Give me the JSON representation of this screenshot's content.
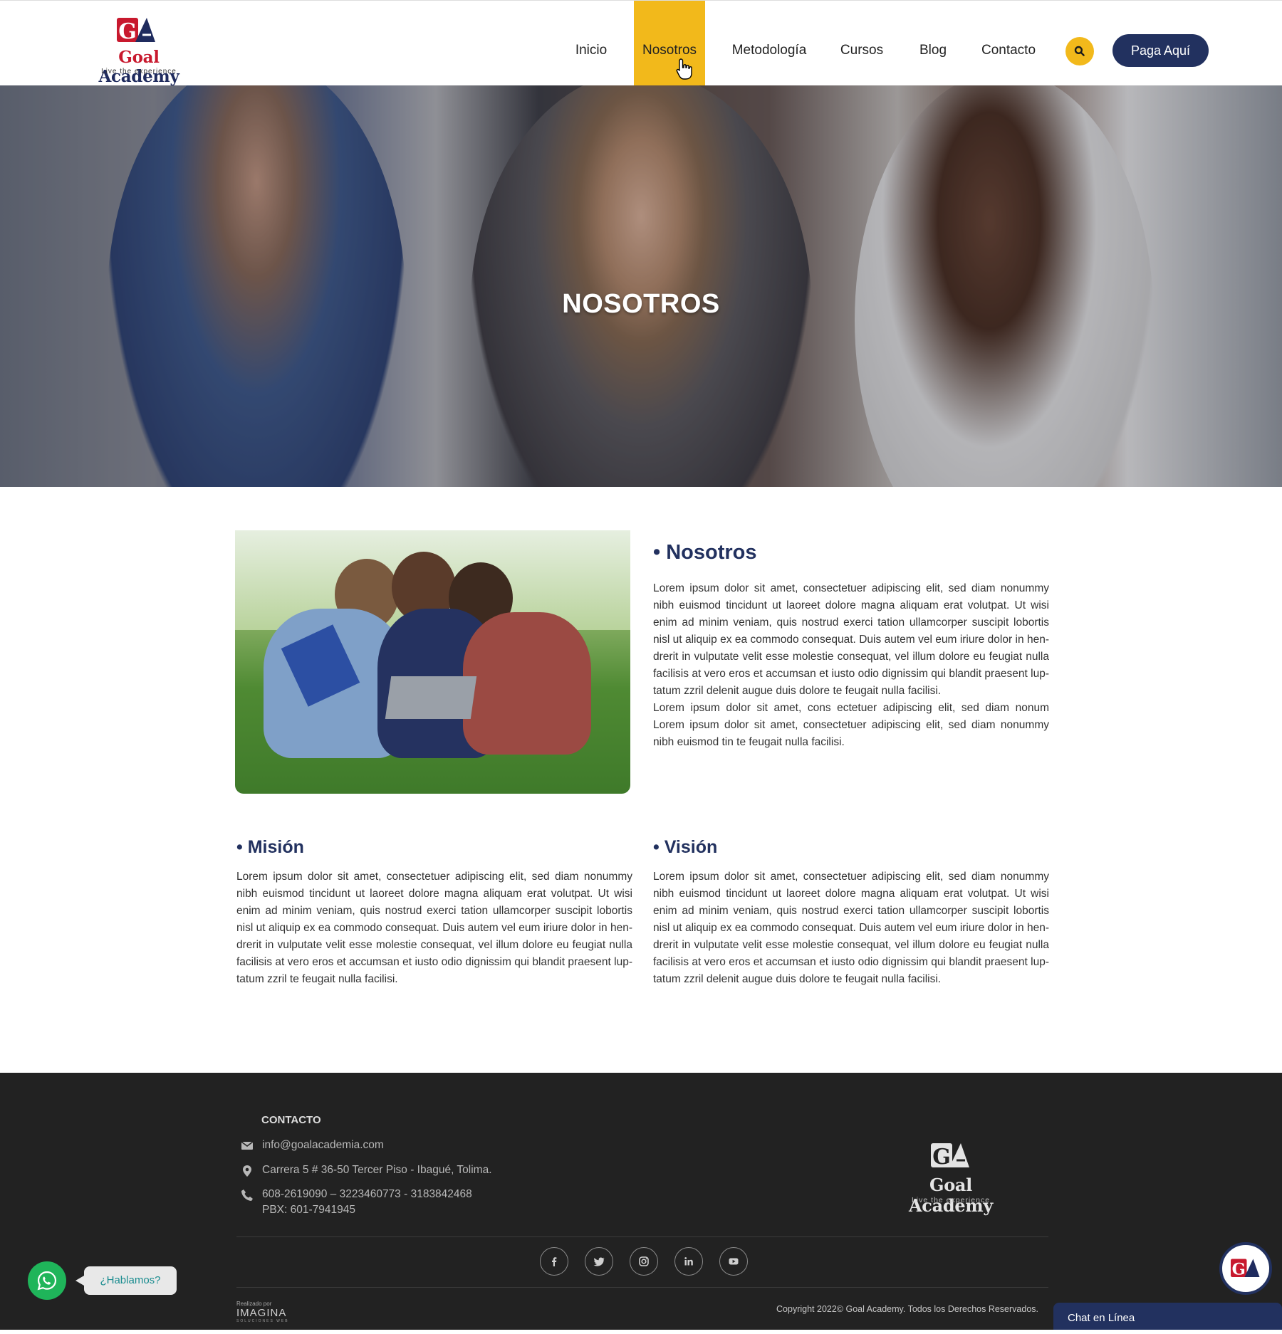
{
  "header": {
    "logo": {
      "name_part1": "Goal",
      "name_part2": "Academy",
      "tagline": "Live the experience",
      "mark": "GA"
    },
    "nav": [
      {
        "label": "Inicio"
      },
      {
        "label": "Nosotros",
        "active": true
      },
      {
        "label": "Metodología"
      },
      {
        "label": "Cursos"
      },
      {
        "label": "Blog"
      },
      {
        "label": "Contacto"
      }
    ],
    "search_icon": "search-icon",
    "pay_button": "Paga Aquí",
    "accent_color": "#f2b91b",
    "brand_color": "#22315f"
  },
  "hero": {
    "title": "NOSOTROS"
  },
  "about": {
    "title": "• Nosotros",
    "paragraphs": [
      "Lorem ipsum dolor sit amet, consectetuer adipiscing elit, sed diam nonummy nibh euismod tincidunt ut laoreet dolore magna aliquam erat volutpat. Ut wisi enim ad minim veniam, quis nostrud exerci tation ullamcorper suscipit lobortis nisl ut aliquip ex ea commodo consequat. Duis autem vel eum iriure dolor in hen-drerit in vulputate velit esse molestie consequat, vel illum dolore eu feugiat nulla facilisis at vero eros et accumsan et iusto odio dignissim qui blandit praesent lup-tatum zzril delenit augue duis dolore te feugait nulla facilisi.",
      "Lorem ipsum dolor sit amet, cons ectetuer adipiscing elit, sed diam nonum Lorem ipsum dolor sit amet, consectetuer adipiscing elit, sed diam nonummy nibh euismod tin te feugait nulla facilisi."
    ]
  },
  "mision": {
    "title": "• Misión",
    "text": "Lorem ipsum dolor sit amet, consectetuer adipiscing elit, sed diam nonummy nibh euismod tincidunt ut laoreet dolore magna aliquam erat volutpat. Ut wisi enim ad minim veniam, quis nostrud exerci tation ullamcorper suscipit lobortis nisl ut aliquip ex ea commodo consequat. Duis autem vel eum iriure dolor in hen-drerit in vulputate velit esse molestie consequat, vel illum dolore eu feugiat nulla facilisis at vero eros et accumsan et iusto odio dignissim qui blandit praesent lup-tatum zzril te feugait nulla facilisi."
  },
  "vision": {
    "title": "• Visión",
    "text": "Lorem ipsum dolor sit amet, consectetuer adipiscing elit, sed diam nonummy nibh euismod tincidunt ut laoreet dolore magna aliquam erat volutpat. Ut wisi enim ad minim veniam, quis nostrud exerci tation ullamcorper suscipit lobortis nisl ut aliquip ex ea commodo consequat. Duis autem vel eum iriure dolor in hen-drerit in vulputate velit esse molestie consequat, vel illum dolore eu feugiat nulla facilisis at vero eros et accumsan et iusto odio dignissim qui blandit praesent lup-tatum zzril delenit augue duis dolore te feugait nulla facilisi."
  },
  "footer": {
    "contact_heading": "CONTACTO",
    "email": "info@goalacademia.com",
    "address": "Carrera 5 # 36-50 Tercer Piso - Ibagué, Tolima.",
    "phones": "608-2619090 – 3223460773 - 3183842468",
    "pbx": "PBX: 601-7941945",
    "logo": {
      "name": "Goal Academy",
      "tagline": "Live the experience",
      "mark": "GA"
    },
    "social_icons": [
      "facebook-icon",
      "twitter-icon",
      "instagram-icon",
      "linkedin-icon",
      "youtube-icon"
    ],
    "madeby": {
      "small": "Realizado por",
      "brand": "IMAGINA",
      "sub": "SOLUCIONES WEB"
    },
    "copyright": "Copyright 2022© Goal Academy. Todos los Derechos Reservados."
  },
  "widgets": {
    "whatsapp_icon": "whatsapp-icon",
    "whatsapp_label": "¿Hablamos?",
    "chat_label": "Chat en Línea",
    "chat_mark": "GA"
  }
}
